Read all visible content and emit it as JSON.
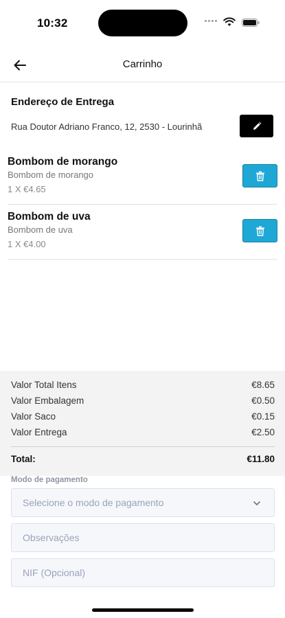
{
  "status_bar": {
    "time": "10:32",
    "icons": [
      "signal-dots-icon",
      "wifi-icon",
      "battery-icon"
    ]
  },
  "header": {
    "back_icon": "arrow-left-icon",
    "title": "Carrinho"
  },
  "address": {
    "title": "Endereço de Entrega",
    "text": "Rua Doutor Adriano Franco, 12, 2530 - Lourinhã",
    "edit_icon": "pencil-icon"
  },
  "items": [
    {
      "name": "Bombom de morango",
      "description": "Bombom de morango",
      "price": "1 X €4.65",
      "delete_icon": "trash-icon"
    },
    {
      "name": "Bombom de uva",
      "description": "Bombom de uva",
      "price": "1 X €4.00",
      "delete_icon": "trash-icon"
    }
  ],
  "summary": {
    "rows": [
      {
        "label": "Valor Total Itens",
        "value": "€8.65"
      },
      {
        "label": "Valor Embalagem",
        "value": "€0.50"
      },
      {
        "label": "Valor Saco",
        "value": "€0.15"
      },
      {
        "label": "Valor Entrega",
        "value": "€2.50"
      }
    ],
    "total_label": "Total:",
    "total_value": "€11.80"
  },
  "payment": {
    "label": "Modo de pagamento",
    "select_placeholder": "Selecione o modo de pagamento",
    "notes_placeholder": "Observações",
    "nif_placeholder": "NIF (Opcional)"
  },
  "colors": {
    "accent": "#1fa8d6",
    "edit_button": "#000000",
    "summary_bg": "#f3f3f3",
    "field_bg": "#f5f7fb",
    "placeholder": "#9aa3b8"
  }
}
